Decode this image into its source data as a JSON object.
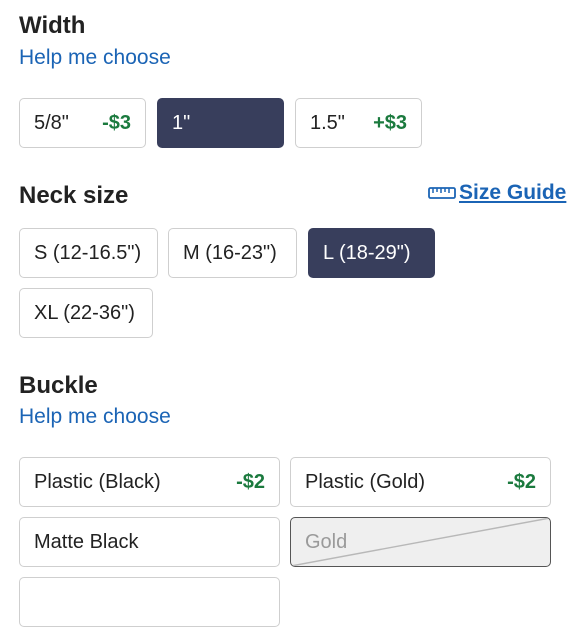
{
  "width": {
    "title": "Width",
    "help": "Help me choose",
    "options": [
      {
        "label": "5/8\"",
        "price": "-$3"
      },
      {
        "label": "1\"",
        "price": ""
      },
      {
        "label": "1.5\"",
        "price": "+$3"
      }
    ],
    "selected": "1\""
  },
  "neck": {
    "title": "Neck size",
    "size_guide": "Size Guide",
    "options": [
      {
        "label": "S (12-16.5\")"
      },
      {
        "label": "M (16-23\")"
      },
      {
        "label": "L (18-29\")"
      },
      {
        "label": "XL (22-36\")"
      }
    ],
    "selected": "L (18-29\")"
  },
  "buckle": {
    "title": "Buckle",
    "help": "Help me choose",
    "options": [
      {
        "label": "Plastic (Black)",
        "price": "-$2"
      },
      {
        "label": "Plastic (Gold)",
        "price": "-$2"
      },
      {
        "label": "Matte Black",
        "price": ""
      },
      {
        "label": "Gold",
        "price": "",
        "state": "unavailable"
      }
    ]
  },
  "colors": {
    "selected_bg": "#383e5c",
    "link": "#1b64b5",
    "price": "#1b7a3e"
  }
}
